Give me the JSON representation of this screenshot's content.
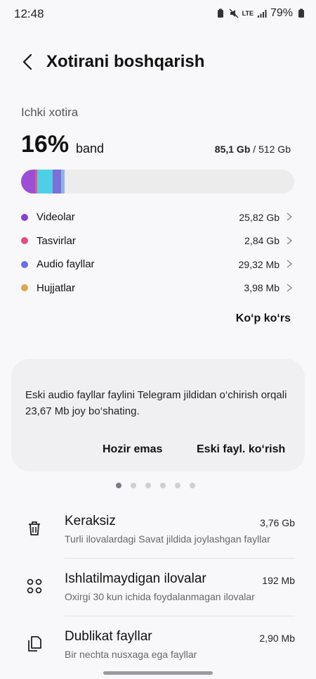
{
  "status_bar": {
    "time": "12:48",
    "network": "LTE",
    "battery": "79%"
  },
  "header": {
    "title": "Xotirani boshqarish"
  },
  "storage": {
    "label": "Ichki xotira",
    "percent": "16%",
    "percent_suffix": "band",
    "used": "85,1 Gb",
    "separator": " / ",
    "total": "512 Gb",
    "bar_fill_fraction": 0.16,
    "bar_colors": [
      "#9b4fd6",
      "#e05a86",
      "#4fcfe6",
      "#7b6fd8",
      "#e0a04a"
    ]
  },
  "categories": [
    {
      "name": "Videolar",
      "size": "25,82 Gb",
      "color": "#8a3fd0"
    },
    {
      "name": "Tasvirlar",
      "size": "2,84 Gb",
      "color": "#e0507c"
    },
    {
      "name": "Audio fayllar",
      "size": "29,32 Mb",
      "color": "#6d6ee0"
    },
    {
      "name": "Hujjatlar",
      "size": "3,98 Mb",
      "color": "#e0a550"
    }
  ],
  "more_label": "Ko‘p ko‘rs",
  "suggestion_card": {
    "message": "Eski audio fayllar faylini Telegram jildidan o‘chirish orqali 23,67 Mb joy bo‘shating.",
    "dismiss_label": "Hozir emas",
    "action_label": "Eski fayl. ko‘rish"
  },
  "pager": {
    "total": 6,
    "active_index": 0
  },
  "list": [
    {
      "icon": "trash-icon",
      "title": "Keraksiz",
      "subtitle": "Turli ilovalardagi Savat jildida joylashgan fayllar",
      "size": "3,76 Gb"
    },
    {
      "icon": "apps-grid-icon",
      "title": "Ishlatilmaydigan ilovalar",
      "subtitle": "Oxirgi 30 kun ichida foydalanmagan ilovalar",
      "size": "192 Mb"
    },
    {
      "icon": "duplicate-files-icon",
      "title": "Dublikat fayllar",
      "subtitle": "Bir nechta nusxaga ega fayllar",
      "size": "2,90 Mb"
    }
  ]
}
